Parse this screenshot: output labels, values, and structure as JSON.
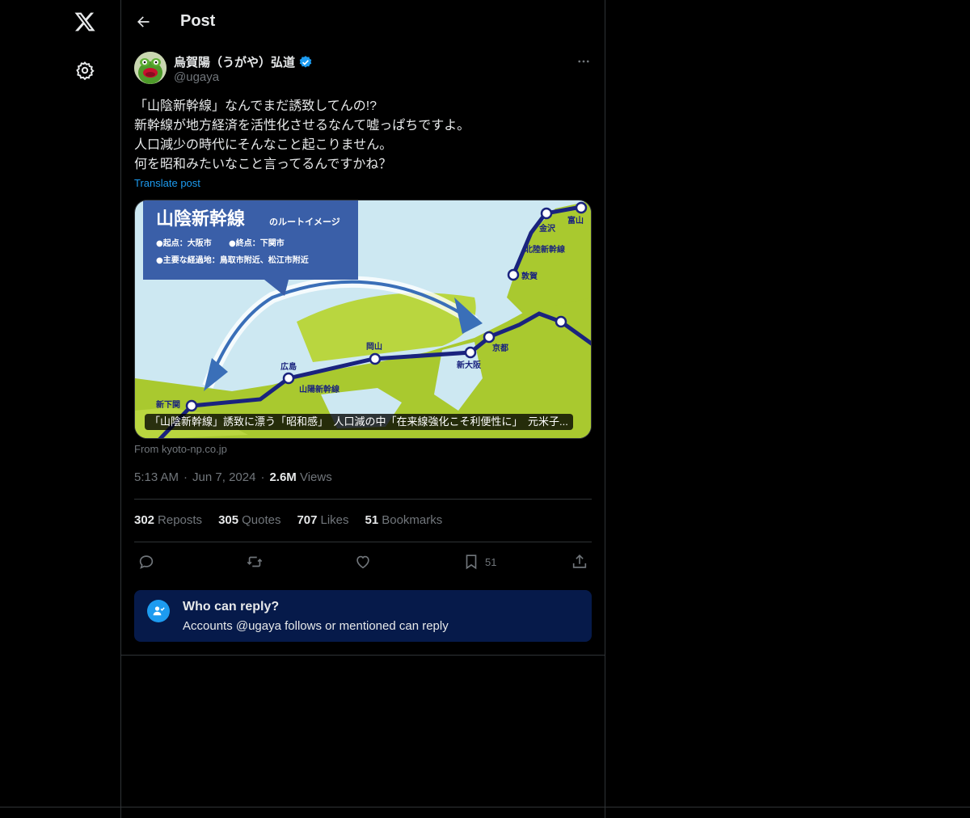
{
  "nav": {
    "logo_icon": "x-logo-icon",
    "settings_icon": "gear-icon"
  },
  "header": {
    "title": "Post"
  },
  "author": {
    "name": "烏賀陽（うがや）弘道",
    "handle": "@ugaya",
    "verified": true
  },
  "tweet": {
    "lines": [
      "「山陰新幹線」なんでまだ誘致してんの!?",
      "新幹線が地方経済を活性化させるなんて嘘っぱちですよ。",
      "人口減少の時代にそんなこと起こりません。",
      "何を昭和みたいなこと言ってるんですかね？"
    ],
    "translate": "Translate post"
  },
  "card": {
    "caption": "「山陰新幹線」誘致に漂う「昭和感」　人口減の中「在来線強化こそ利便性に」　元米子...",
    "source": "From kyoto-np.co.jp",
    "map": {
      "title_main": "山陰新幹線",
      "title_sub": "のルートイメージ",
      "line1a": "●起点：大阪市",
      "line1b": "●終点：下関市",
      "line2": "●主要な経過地：鳥取市附近、松江市附近",
      "stations": [
        "金沢",
        "富山",
        "北陸新幹線",
        "敦賀",
        "京都",
        "新大阪",
        "岡山",
        "広島",
        "山陽新幹線",
        "新下関"
      ]
    }
  },
  "meta": {
    "time": "5:13 AM",
    "date": "Jun 7, 2024",
    "dot": "·",
    "views_count": "2.6M",
    "views_label": "Views"
  },
  "stats": {
    "reposts_count": "302",
    "reposts_label": "Reposts",
    "quotes_count": "305",
    "quotes_label": "Quotes",
    "likes_count": "707",
    "likes_label": "Likes",
    "bookmarks_count": "51",
    "bookmarks_label": "Bookmarks"
  },
  "actions": {
    "bookmark_count": "51"
  },
  "reply_box": {
    "title": "Who can reply?",
    "subtitle": "Accounts @ugaya follows or mentioned can reply"
  },
  "colors": {
    "accent": "#1d9bf0",
    "background": "#000000",
    "reply_box": "#061a4a",
    "muted": "#71767b"
  }
}
